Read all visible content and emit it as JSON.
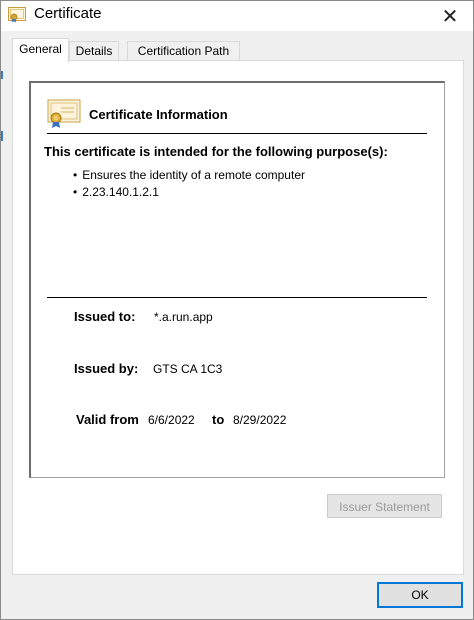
{
  "window": {
    "title": "Certificate",
    "close_glyph": "✕"
  },
  "tabs": [
    {
      "label": "General",
      "active": true
    },
    {
      "label": "Details",
      "active": false
    },
    {
      "label": "Certification Path",
      "active": false
    }
  ],
  "info": {
    "heading": "Certificate Information",
    "purpose_title": "This certificate is intended for the following purpose(s):",
    "purposes": [
      "Ensures the identity of a remote computer",
      "2.23.140.1.2.1"
    ]
  },
  "fields": {
    "issued_to_label": "Issued to:",
    "issued_to_value": "*.a.run.app",
    "issued_by_label": "Issued by:",
    "issued_by_value": "GTS CA 1C3",
    "valid_from_label": "Valid from",
    "valid_from_value": "6/6/2022",
    "to_label": "to",
    "valid_to_value": "8/29/2022"
  },
  "buttons": {
    "issuer_statement": "Issuer Statement",
    "ok": "OK"
  },
  "icons": {
    "title_icon": "certificate-icon",
    "info_icon": "certificate-icon"
  },
  "colors": {
    "focus_border": "#0078d7",
    "disabled_text": "#9a9a9a"
  }
}
